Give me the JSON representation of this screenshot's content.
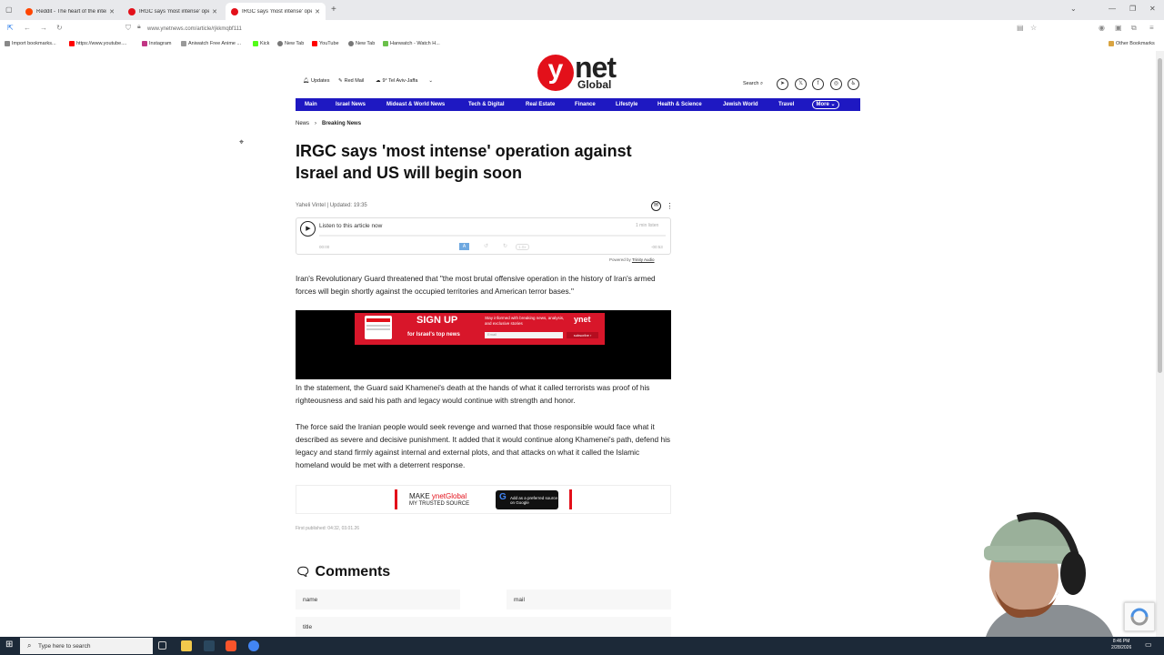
{
  "browser": {
    "tabs": [
      {
        "label": "Reddit - The heart of the internet",
        "favicon_color": "#ff4500"
      },
      {
        "label": "IRGC says 'most intense' operatio",
        "favicon_color": "#e3101a"
      },
      {
        "label": "IRGC says 'most intense' operatio",
        "favicon_color": "#e3101a",
        "active": true
      }
    ],
    "url": "www.ynetnews.com/article/rjkkmqbf111",
    "bookmarks": [
      {
        "label": "Import bookmarks...",
        "color": "#888"
      },
      {
        "label": "https://www.youtube....",
        "color": "#ff0000"
      },
      {
        "label": "Instagram",
        "color": "#c13584"
      },
      {
        "label": "Aniwatch Free Anime ...",
        "color": "#999"
      },
      {
        "label": "Kick",
        "color": "#53fc18"
      },
      {
        "label": "New Tab",
        "color": "#777"
      },
      {
        "label": "YouTube",
        "color": "#ff0000"
      },
      {
        "label": "New Tab",
        "color": "#777"
      },
      {
        "label": "Hanwatch - Watch H...",
        "color": "#6bc04b"
      }
    ],
    "other_bookmarks": "Other Bookmarks"
  },
  "site": {
    "logo_y": "y",
    "logo_net": "net",
    "logo_global": "Global",
    "updates": "Updates",
    "red_mail": "Red Mail",
    "weather": "9° Tel Aviv-Jaffa",
    "search": "Search",
    "nav": [
      "Main",
      "Israel News",
      "Mideast & World News",
      "Tech & Digital",
      "Real Estate",
      "Finance",
      "Lifestyle",
      "Health & Science",
      "Jewish World",
      "Travel"
    ],
    "nav_more": "More",
    "accent": "#1e18c2",
    "brand_red": "#e3101a"
  },
  "article": {
    "breadcrumb": [
      "News",
      "Breaking News"
    ],
    "title": "IRGC says 'most intense' operation against Israel and US will begin soon",
    "author": "Yaheli Vintel",
    "updated": "Updated: 19:35",
    "audio": {
      "listen": "Listen to this article now",
      "duration_label": "1 min listen",
      "start_time": "00:00",
      "end_time": "-00:53",
      "speed": "1.0x",
      "powered_by": "Powered by",
      "powered_name": "Trinity Audio"
    },
    "paragraphs": [
      "Iran's Revolutionary Guard threatened that \"the most brutal offensive operation in the history of Iran's armed forces will begin shortly against the occupied territories and American terror bases.\"",
      "In the statement, the Guard said Khamenei's death at the hands of what it called terrorists was proof of his righteousness and said his path and legacy would continue with strength and honor.",
      "The force said the Iranian people would seek revenge and warned that those responsible would face what it described as severe and decisive punishment. It added that it would continue along Khamenei's path, defend his legacy and stand firmly against internal and external plots, and that attacks on what it called the Islamic homeland would be met with a deterrent response."
    ],
    "ad": {
      "sign_up": "SIGN UP",
      "top_news": "for Israel's top news",
      "info": "Stay informed with breaking news, analysis, and exclusive stories",
      "email": "Email",
      "subscribe": "subscribe ›",
      "logo": "ynet"
    },
    "trusted": {
      "make": "MAKE ",
      "brand": "ynetGlobal",
      "my_source": "MY TRUSTED SOURCE",
      "google_btn": "Add as a preferred source on Google",
      "google_g": "G"
    },
    "first_published": "First published: 04:32, 03.01.26"
  },
  "comments": {
    "heading": "Comments",
    "name_placeholder": "name",
    "mail_placeholder": "mail",
    "title_placeholder": "title"
  },
  "taskbar": {
    "search_placeholder": "Type here to search",
    "time": "8:46 PM",
    "date": "2/28/2026"
  }
}
